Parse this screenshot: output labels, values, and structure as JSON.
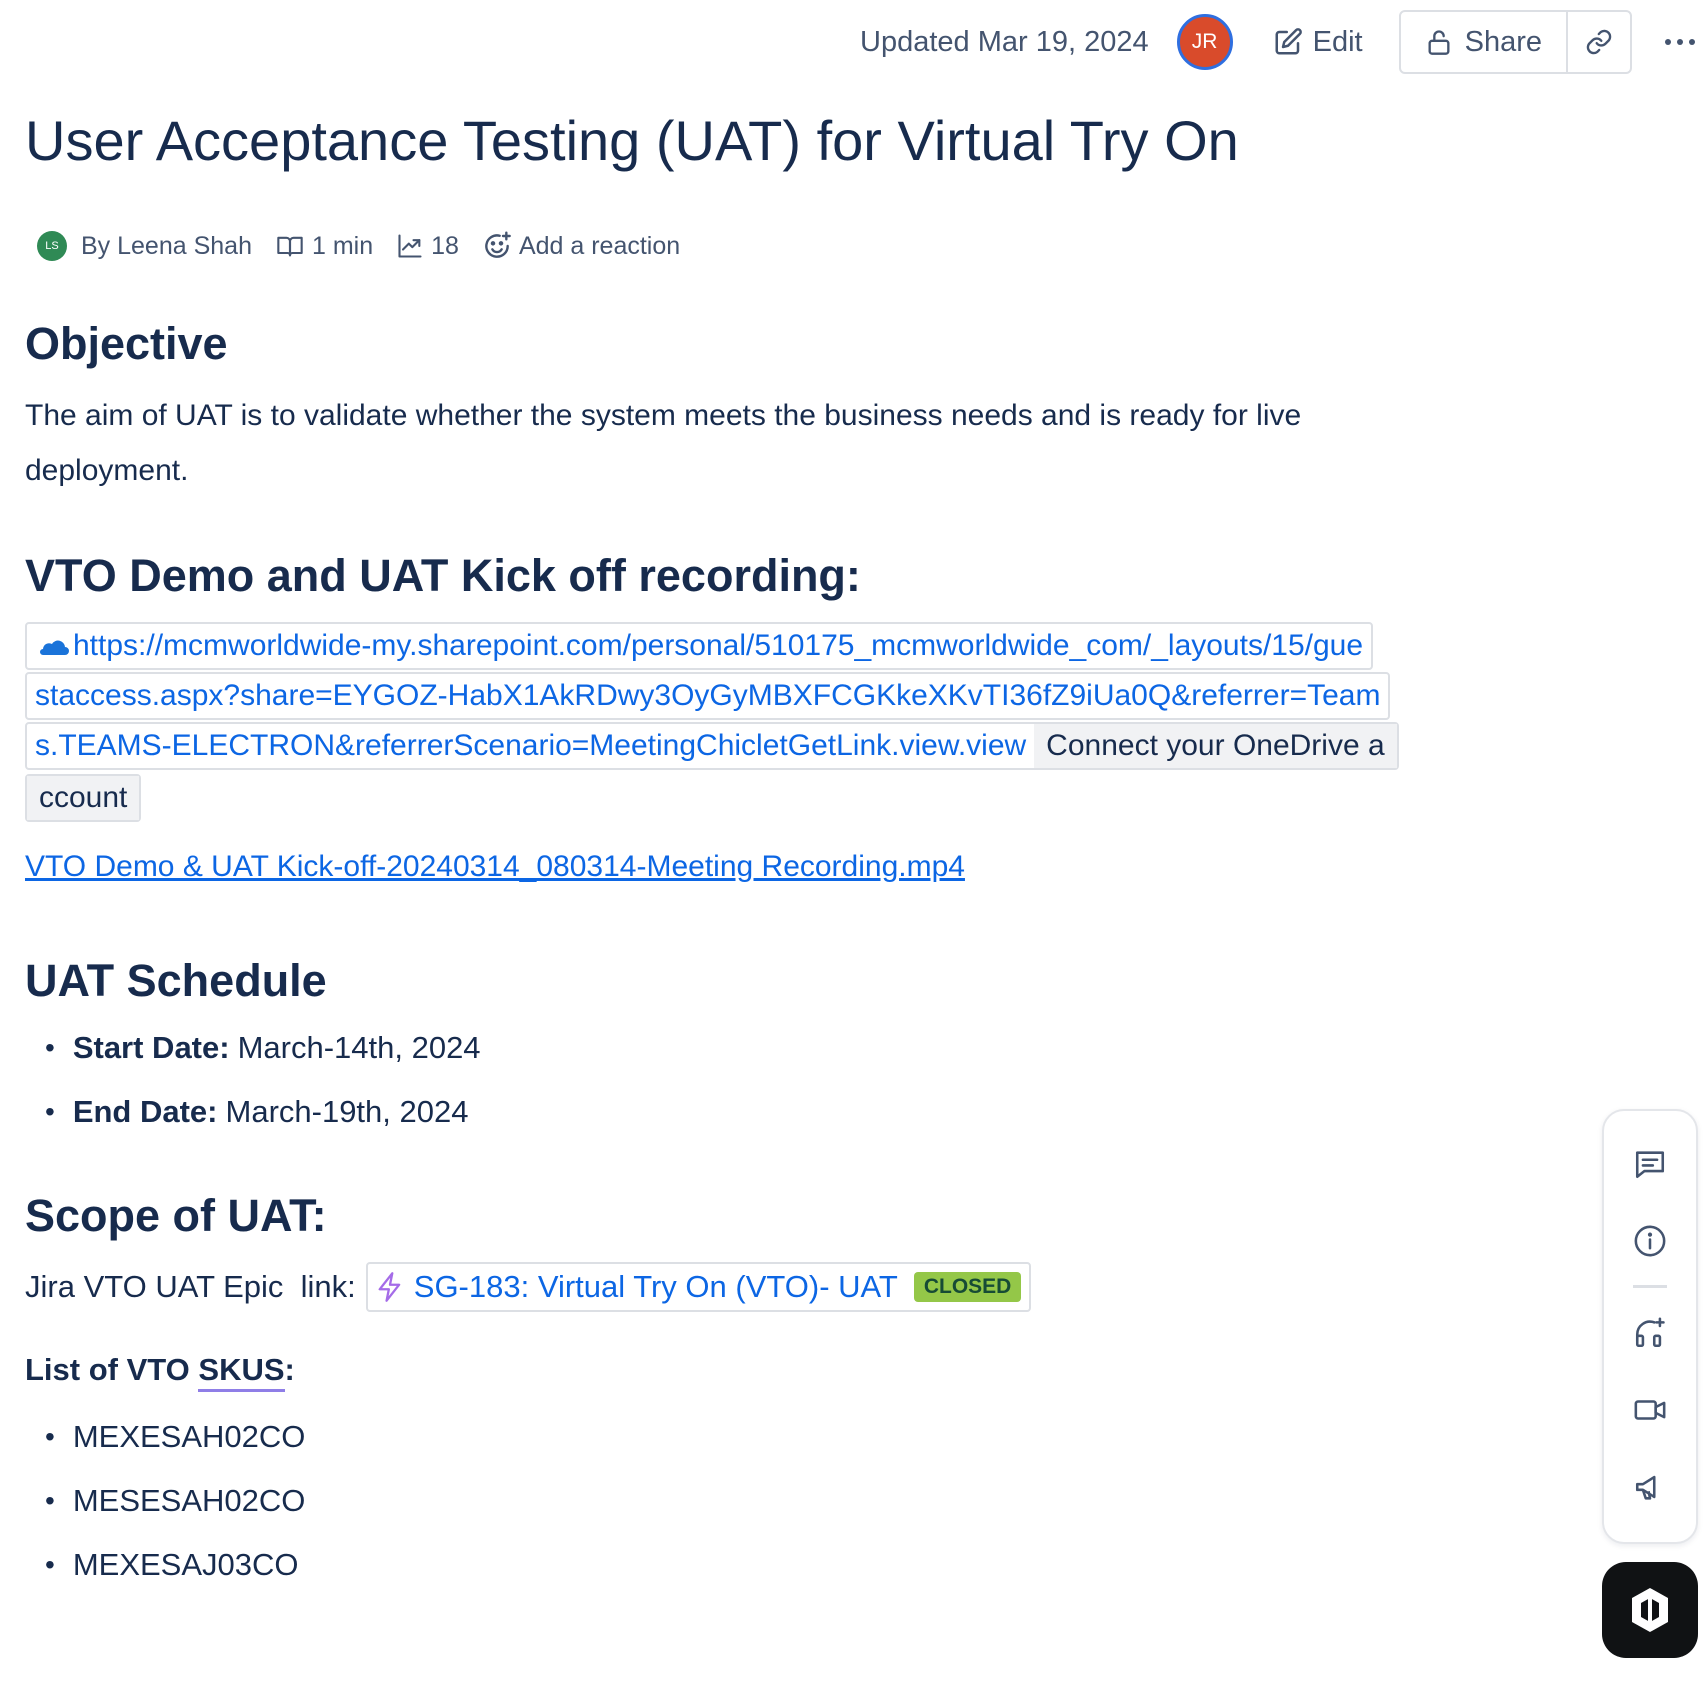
{
  "header": {
    "updated": "Updated Mar 19, 2024",
    "viewer_initials": "JR",
    "edit_label": "Edit",
    "share_label": "Share"
  },
  "page": {
    "title": "User Acceptance Testing (UAT) for Virtual Try On",
    "author_initials": "LS",
    "author": "By Leena Shah",
    "read_time": "1 min",
    "views": "18",
    "reaction_label": "Add a reaction"
  },
  "objective": {
    "heading": "Objective",
    "text": "The aim of UAT is to validate whether the system meets the business needs and is ready for live deployment."
  },
  "recording": {
    "heading": "VTO Demo and UAT Kick off recording:",
    "url_line1": "https://mcmworldwide-my.sharepoint.com/personal/510175_mcmworldwide_com/_layouts/15/gue",
    "url_line2": "staccess.aspx?share=EYGOZ-HabX1AkRDwy3OyGyMBXFCGKkeXKvTI36fZ9iUa0Q&referrer=Team",
    "url_line3": "s.TEAMS-ELECTRON&referrerScenario=MeetingChicletGetLink.view.view",
    "connect_part1": "Connect your OneDrive a",
    "connect_part2": "ccount",
    "file_link": "VTO Demo & UAT Kick-off-20240314_080314-Meeting Recording.mp4"
  },
  "schedule": {
    "heading": "UAT Schedule",
    "start_label": "Start Date:",
    "start_value": "March-14th, 2024",
    "end_label": "End Date:",
    "end_value": "March-19th, 2024"
  },
  "scope": {
    "heading": "Scope of UAT:",
    "jira_label": "Jira VTO UAT Epic  link:",
    "jira_issue": "SG-183: Virtual Try On (VTO)- UAT",
    "jira_status": "CLOSED",
    "skus_prefix": "List of VTO ",
    "skus_underlined": "SKUS",
    "skus_suffix": ":",
    "skus": [
      "MEXESAH02CO",
      "MESESAH02CO",
      "MEXESAJ03CO"
    ]
  },
  "colors": {
    "link": "#0c66e4",
    "text": "#172b4d",
    "lozenge_bg": "#94c748"
  }
}
